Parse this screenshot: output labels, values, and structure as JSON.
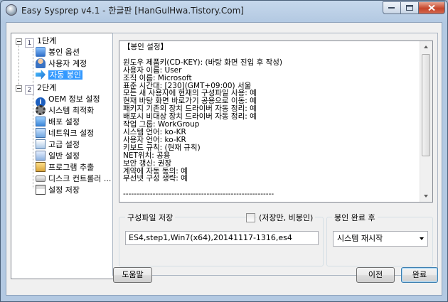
{
  "window": {
    "title": "Easy Sysprep v4.1 - 한글판 [HanGulHwa.Tistory.Com]"
  },
  "tree": {
    "stage1": {
      "number": "1",
      "label": "1단계"
    },
    "stage1_items": [
      {
        "label": "봉인 옵션",
        "icon": "monitor-icon"
      },
      {
        "label": "사용자 계정",
        "icon": "user-icon"
      },
      {
        "label": "자동 봉인",
        "icon": "arrow-icon",
        "selected": true
      }
    ],
    "stage2": {
      "number": "2",
      "label": "2단계"
    },
    "stage2_items": [
      {
        "label": "OEM 정보 설정",
        "icon": "info-icon"
      },
      {
        "label": "시스템 최적화",
        "icon": "gear-icon"
      },
      {
        "label": "배포 설정",
        "icon": "deploy-icon"
      },
      {
        "label": "네트워크 설정",
        "icon": "network-icon"
      },
      {
        "label": "고급 설정",
        "icon": "advanced-icon"
      },
      {
        "label": "일반 설정",
        "icon": "general-icon"
      },
      {
        "label": "프로그램 추출",
        "icon": "program-icon"
      },
      {
        "label": "디스크 컨트롤러 ...",
        "icon": "disk-icon"
      },
      {
        "label": "설정 저장",
        "icon": "save-icon"
      }
    ]
  },
  "log": {
    "lines": [
      "【봉인 설정】",
      "",
      "윈도우 제품키(CD-KEY): (바탕 화면 진입 후 작성)",
      "사용자 이름: User",
      "조직 이름: Microsoft",
      "표준 시간대: [230](GMT+09:00) 서울",
      "모든 새 사용자에 현재의 구성파일 사용: 예",
      "현재 바탕 화면 바로가기 공용으로 이동: 예",
      "패키지 기존의 장치 드라이버 자동 정리: 예",
      "배포시 비대상 장치 드라이버 자동 정리: 예",
      "작업 그룹: WorkGroup",
      "시스템 언어: ko-KR",
      "사용자 언어: ko-KR",
      "키보드 규칙: (현재 규칙)",
      "NET위치: 공용",
      "보안 갱신: 권장",
      "계약에 자동 동의: 예",
      "무선넷 구성 생략: 예",
      "",
      "--------------------------------------------------------"
    ]
  },
  "config_group": {
    "label": "구성파일 저장",
    "checkbox_label": "(저장만, 비봉인)",
    "checkbox_checked": false,
    "filename": "ES4,step1,Win7(x64),20141117-1316,es4"
  },
  "after_group": {
    "label": "봉인 완료 후",
    "selected": "시스템 재시작"
  },
  "buttons": {
    "help": "도움말",
    "prev": "이전",
    "finish": "완료"
  }
}
